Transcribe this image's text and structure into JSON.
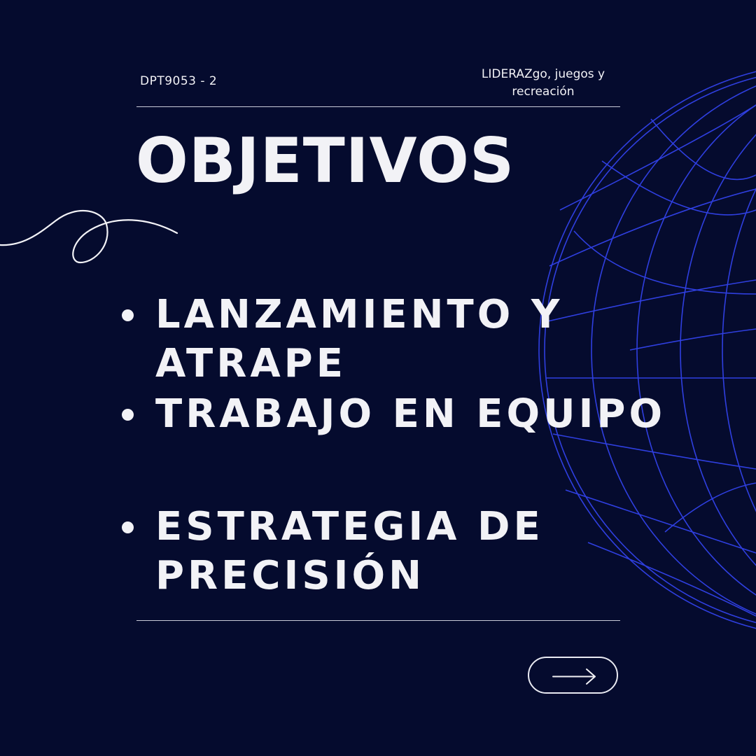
{
  "header": {
    "course_code": "DPT9053 - 2",
    "course_name_line1": "LIDERAZgo, juegos y",
    "course_name_line2": "recreación"
  },
  "title": "OBJETIVOS",
  "objectives": [
    {
      "line1": "LANZAMIENTO Y",
      "line2": "ATRAPE"
    },
    {
      "line1": "TRABAJO EN EQUIPO",
      "line2": ""
    },
    {
      "line1": "ESTRATEGIA DE",
      "line2": "PRECISIÓN"
    }
  ],
  "navigation": {
    "next_icon": "arrow-right-icon"
  },
  "colors": {
    "background": "#050b2e",
    "text": "#f2f2f6",
    "globe_lines": "#2f3fe0",
    "rule": "#c9cbd8"
  }
}
